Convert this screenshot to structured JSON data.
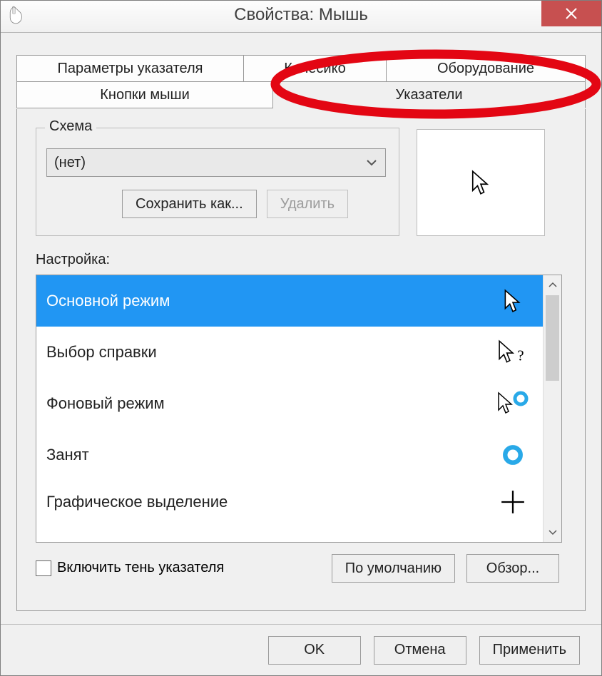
{
  "window": {
    "title": "Свойства: Мышь"
  },
  "tabs": {
    "row1": [
      "Параметры указателя",
      "Колесико",
      "Оборудование"
    ],
    "row2": [
      "Кнопки мыши",
      "Указатели"
    ]
  },
  "scheme": {
    "label": "Схема",
    "selected": "(нет)",
    "save_as": "Сохранить как...",
    "delete": "Удалить"
  },
  "settings": {
    "label": "Настройка:",
    "items": [
      {
        "name": "Основной режим",
        "cursor": "arrow",
        "selected": true
      },
      {
        "name": "Выбор справки",
        "cursor": "arrow-help",
        "selected": false
      },
      {
        "name": "Фоновый режим",
        "cursor": "arrow-busy",
        "selected": false
      },
      {
        "name": "Занят",
        "cursor": "busy",
        "selected": false
      },
      {
        "name": "Графическое выделение",
        "cursor": "cross",
        "selected": false
      }
    ]
  },
  "shadow_check": "Включить тень указателя",
  "buttons": {
    "defaults": "По умолчанию",
    "browse": "Обзор...",
    "ok": "OK",
    "cancel": "Отмена",
    "apply": "Применить"
  }
}
